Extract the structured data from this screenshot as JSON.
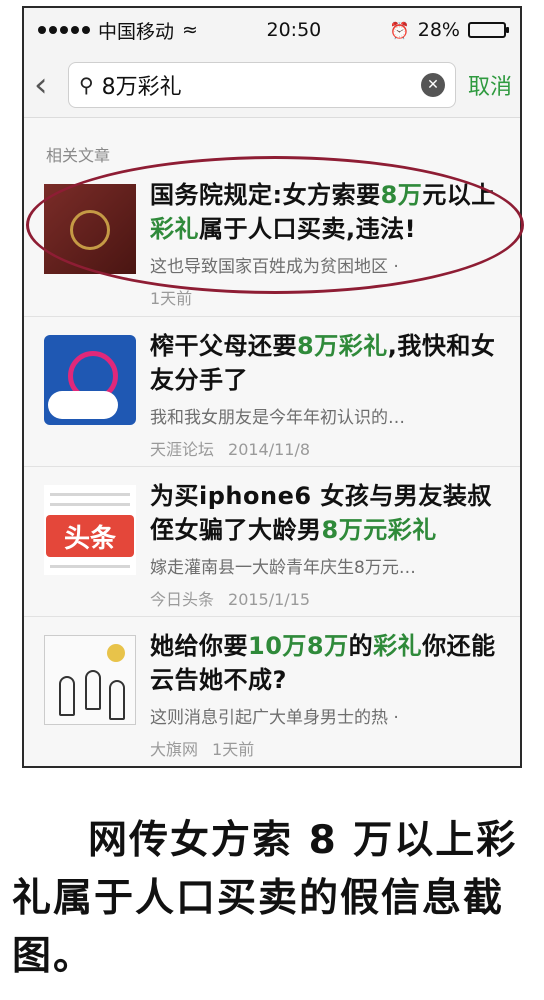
{
  "status_bar": {
    "carrier": "中国移动",
    "time": "20:50",
    "battery": "28%",
    "battery_level": 0.28
  },
  "search": {
    "query": "8万彩礼",
    "cancel_label": "取消"
  },
  "section_label": "相关文章",
  "results": [
    {
      "title_parts": [
        {
          "t": "国务院规定:女方索要",
          "hl": false
        },
        {
          "t": "8万",
          "hl": true
        },
        {
          "t": "元以上",
          "hl": false
        },
        {
          "t": "彩礼",
          "hl": true
        },
        {
          "t": "属于人口买卖,违法!",
          "hl": false
        }
      ],
      "snippet": "这也导致国家百姓成为贫困地区 ·",
      "source": "",
      "date": "1天前",
      "thumb": "passport-image"
    },
    {
      "title_parts": [
        {
          "t": "榨干父母还要",
          "hl": false
        },
        {
          "t": "8万彩礼",
          "hl": true
        },
        {
          "t": ",我快和女友分手了",
          "hl": false
        }
      ],
      "snippet": "我和我女朋友是今年年初认识的…",
      "source": "天涯论坛",
      "date": "2014/11/8",
      "thumb": "globe-logo"
    },
    {
      "title_parts": [
        {
          "t": "为买iphone6 女孩与男友装叔侄女骗了大龄男",
          "hl": false
        },
        {
          "t": "8万元彩礼",
          "hl": true
        }
      ],
      "snippet": "嫁走灌南县一大龄青年庆生8万元…",
      "source": "今日头条",
      "date": "2015/1/15",
      "thumb": "toutiao-logo",
      "thumb_text": "头条"
    },
    {
      "title_parts": [
        {
          "t": "她给你要",
          "hl": false
        },
        {
          "t": "10万8万",
          "hl": true
        },
        {
          "t": "的",
          "hl": false
        },
        {
          "t": "彩礼",
          "hl": true
        },
        {
          "t": "你还能云告她不成?",
          "hl": false
        }
      ],
      "snippet": "这则消息引起广大单身男士的热 ·",
      "source": "大旗网",
      "date": "1天前",
      "thumb": "cartoon-image"
    }
  ],
  "caption": "网传女方索 8 万以上彩礼属于人口买卖的假信息截图。"
}
